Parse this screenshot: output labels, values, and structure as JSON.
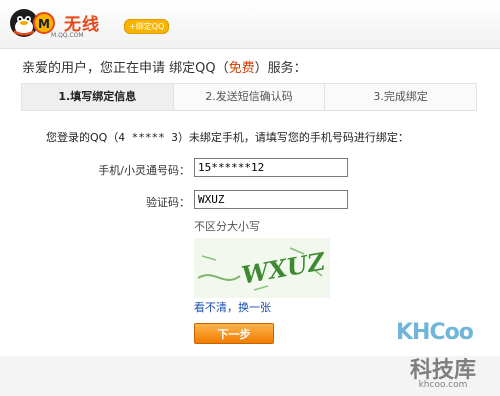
{
  "header": {
    "logo_text": "无线",
    "logo_url": "M.QQ.COM",
    "badge": "+绑定QQ"
  },
  "intro": {
    "prefix": "亲爱的用户，您正在申请 绑定QQ（",
    "free": "免费",
    "suffix": "）服务："
  },
  "steps": [
    {
      "label": "1.填写绑定信息",
      "active": true
    },
    {
      "label": "2.发送短信确认码",
      "active": false
    },
    {
      "label": "3.完成绑定",
      "active": false
    }
  ],
  "notice": {
    "prefix": "您登录的QQ（",
    "qq": "4 ***** 3",
    "suffix": "）未绑定手机，请填写您的手机号码进行绑定："
  },
  "form": {
    "phone_label": "手机/小灵通号码：",
    "phone_value": "15******12",
    "captcha_label": "验证码：",
    "captcha_value": "WXUZ",
    "case_hint": "不区分大小写",
    "captcha_text": "WXUZ",
    "refresh_link": "看不清，换一张",
    "next_button": "下一步"
  },
  "watermark": {
    "logo": "KHCoo",
    "name": "科技库",
    "url": "khcoo.com"
  },
  "colors": {
    "accent": "#f07c00",
    "link": "#1a4fb0",
    "captcha_ink": "#3e8a32"
  }
}
